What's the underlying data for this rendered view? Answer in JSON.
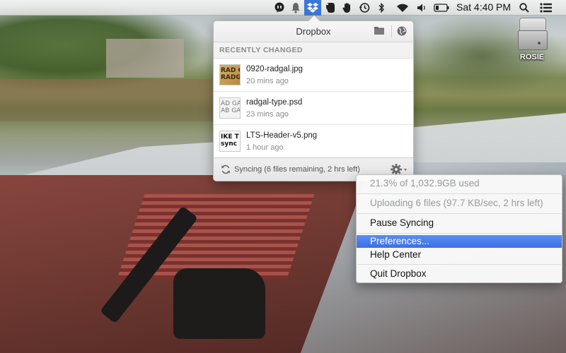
{
  "menubar": {
    "clock": "Sat 4:40 PM",
    "status_icons": [
      "chat-icon",
      "notification-bell-icon",
      "dropbox-icon",
      "evernote-icon",
      "hand-icon",
      "time-machine-icon",
      "bluetooth-icon",
      "wifi-icon",
      "volume-icon",
      "battery-icon",
      "spotlight-icon",
      "notification-center-icon"
    ],
    "accent_color": "#3c78d8"
  },
  "desktop": {
    "drive_label": "ROSIE"
  },
  "dropbox_panel": {
    "title": "Dropbox",
    "section_label": "RECENTLY CHANGED",
    "files": [
      {
        "name": "0920-radgal.jpg",
        "time": "20 mins ago",
        "thumb": "RAD GAL\nRADGAL"
      },
      {
        "name": "radgal-type.psd",
        "time": "23 mins ago",
        "thumb": "AD GA\nAB GA"
      },
      {
        "name": "LTS-Header-v5.png",
        "time": "1 hour ago",
        "thumb": "IKE T\nsync"
      }
    ],
    "status_text": "Syncing (6 files remaining, 2 hrs left)"
  },
  "context_menu": {
    "usage": "21.3% of 1,032.9GB used",
    "uploading": "Uploading 6 files (97.7 KB/sec, 2 hrs left)",
    "pause": "Pause Syncing",
    "preferences": "Preferences...",
    "help": "Help Center",
    "quit": "Quit Dropbox",
    "highlight_color": "#3b6fe6"
  }
}
